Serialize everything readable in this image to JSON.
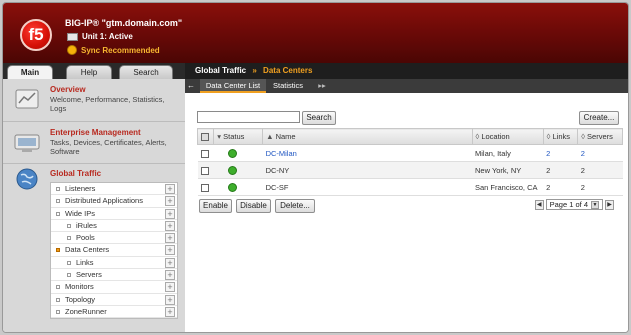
{
  "header": {
    "hostname": "BIG-IP® \"gtm.domain.com\"",
    "unit": "Unit 1: Active",
    "sync_status": "Sync Recommended",
    "logo_text": "f5"
  },
  "left_tabs": [
    "Main",
    "Help",
    "Search"
  ],
  "sidebar": {
    "sections": [
      {
        "title": "Overview",
        "desc": "Welcome, Performance, Statistics, Logs"
      },
      {
        "title": "Enterprise Management",
        "desc": "Tasks, Devices, Certificates, Alerts, Software"
      },
      {
        "title": "Global Traffic",
        "desc": ""
      }
    ],
    "global_traffic_items": [
      {
        "label": "Listeners",
        "indent": 0,
        "active": false
      },
      {
        "label": "Distributed Applications",
        "indent": 0,
        "active": false
      },
      {
        "label": "Wide IPs",
        "indent": 0,
        "active": false
      },
      {
        "label": "iRules",
        "indent": 1,
        "active": false
      },
      {
        "label": "Pools",
        "indent": 1,
        "active": false
      },
      {
        "label": "Data Centers",
        "indent": 0,
        "active": true
      },
      {
        "label": "Links",
        "indent": 1,
        "active": false
      },
      {
        "label": "Servers",
        "indent": 1,
        "active": false
      },
      {
        "label": "Monitors",
        "indent": 0,
        "active": false
      },
      {
        "label": "Topology",
        "indent": 0,
        "active": false
      },
      {
        "label": "ZoneRunner",
        "indent": 0,
        "active": false
      }
    ]
  },
  "breadcrumb": {
    "section": "Global Traffic",
    "separator": "»",
    "page": "Data Centers"
  },
  "subtabs": [
    "Data Center List",
    "Statistics"
  ],
  "toolbar": {
    "search_button": "Search",
    "create_button": "Create...",
    "search_value": ""
  },
  "table": {
    "headers": {
      "status": "Status",
      "name": "Name",
      "location": "Location",
      "links": "Links",
      "servers": "Servers"
    },
    "rows": [
      {
        "name": "DC-Milan",
        "location": "Milan, Italy",
        "links": "2",
        "servers": "2",
        "linked": true
      },
      {
        "name": "DC-NY",
        "location": "New York, NY",
        "links": "2",
        "servers": "2",
        "linked": false
      },
      {
        "name": "DC-SF",
        "location": "San Francisco, CA",
        "links": "2",
        "servers": "2",
        "linked": false
      }
    ]
  },
  "actions": {
    "enable": "Enable",
    "disable": "Disable",
    "delete": "Delete..."
  },
  "pager": {
    "label": "Page 1 of 4"
  },
  "colors": {
    "brand_red": "#8a0f0b",
    "accent_orange": "#f0a020",
    "status_green": "#3eae2c",
    "link_blue": "#1f56c2"
  }
}
